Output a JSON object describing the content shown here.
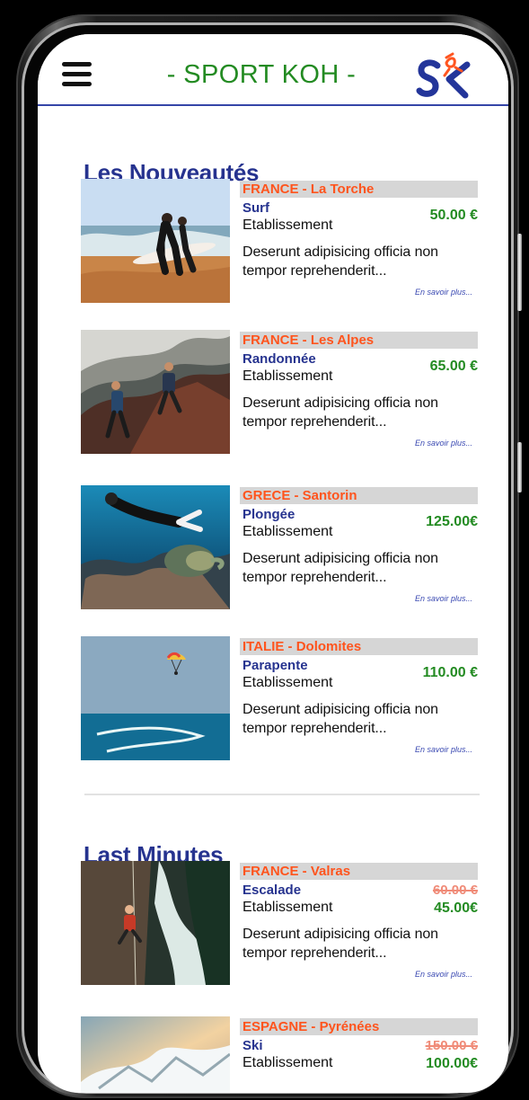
{
  "app": {
    "title": "- SPORT KOH -",
    "logo_icon": "sport-koh-logo",
    "menu_icon": "hamburger-menu-icon"
  },
  "colors": {
    "brand_green": "#238b22",
    "section_blue": "#26338f",
    "location_orange": "#ff541d",
    "location_background": "#d6d6d6",
    "old_price": "#f08b78"
  },
  "sections": {
    "new_title": "Les Nouveautés",
    "last_title": "Last Minutes"
  },
  "cards": [
    {
      "location": "FRANCE - La Torche",
      "activity": "Surf",
      "establishment": "Etablissement",
      "price": "50.00 €",
      "description": "Deserunt adipisicing officia non tempor reprehenderit...",
      "link": "En savoir plus...",
      "image_icon": "surf-photo"
    },
    {
      "location": "FRANCE - Les Alpes",
      "activity": "Randonnée",
      "establishment": "Etablissement",
      "price": "65.00 €",
      "description": "Deserunt adipisicing officia non tempor reprehenderit...",
      "link": "En savoir plus...",
      "image_icon": "hiking-photo"
    },
    {
      "location": "GRECE - Santorin",
      "activity": "Plongée",
      "establishment": "Etablissement",
      "price": "125.00€",
      "description": "Deserunt adipisicing officia non tempor reprehenderit...",
      "link": "En savoir plus...",
      "image_icon": "diving-photo"
    },
    {
      "location": "ITALIE - Dolomites",
      "activity": "Parapente",
      "establishment": "Etablissement",
      "price": "110.00 €",
      "description": "Deserunt adipisicing officia non tempor reprehenderit...",
      "link": "En savoir plus...",
      "image_icon": "paragliding-photo"
    }
  ],
  "last_cards": [
    {
      "location": "FRANCE - Valras",
      "activity": "Escalade",
      "establishment": "Etablissement",
      "old_price": "60.00 €",
      "new_price": "45.00€",
      "description": "Deserunt adipisicing officia non tempor reprehenderit...",
      "link": "En savoir plus...",
      "image_icon": "climbing-photo"
    },
    {
      "location": "ESPAGNE - Pyrénées",
      "activity": "Ski",
      "establishment": "Etablissement",
      "old_price": "150.00 €",
      "new_price": "100.00€",
      "image_icon": "ski-photo"
    }
  ]
}
